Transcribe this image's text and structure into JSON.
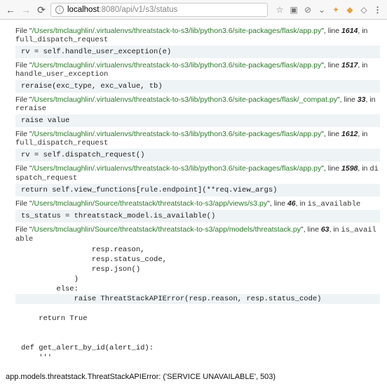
{
  "browser": {
    "url_host": "localhost",
    "url_port": ":8080",
    "url_path": "/api/v1/s3/status"
  },
  "frames": [
    {
      "path": "/Users/tmclaughlin/.virtualenvs/threatstack-to-s3/lib/python3.6/site-packages/flask/app.py",
      "line": "1614",
      "func": "full_dispatch_request",
      "code": "rv = self.handle_user_exception(e)"
    },
    {
      "path": "/Users/tmclaughlin/.virtualenvs/threatstack-to-s3/lib/python3.6/site-packages/flask/app.py",
      "line": "1517",
      "func": "handle_user_exception",
      "code": "reraise(exc_type, exc_value, tb)"
    },
    {
      "path": "/Users/tmclaughlin/.virtualenvs/threatstack-to-s3/lib/python3.6/site-packages/flask/_compat.py",
      "line": "33",
      "func": "reraise",
      "code": "raise value"
    },
    {
      "path": "/Users/tmclaughlin/.virtualenvs/threatstack-to-s3/lib/python3.6/site-packages/flask/app.py",
      "line": "1612",
      "func": "full_dispatch_request",
      "code": "rv = self.dispatch_request()"
    },
    {
      "path": "/Users/tmclaughlin/.virtualenvs/threatstack-to-s3/lib/python3.6/site-packages/flask/app.py",
      "line": "1598",
      "func": "dispatch_request",
      "code": "return self.view_functions[rule.endpoint](**req.view_args)"
    },
    {
      "path": "/Users/tmclaughlin/Source/threatstack/threatstack-to-s3/app/views/s3.py",
      "line": "46",
      "func": "is_available",
      "code": "ts_status = threatstack_model.is_available()"
    }
  ],
  "last_frame": {
    "path": "/Users/tmclaughlin/Source/threatstack/threatstack-to-s3/app/models/threatstack.py",
    "line": "63",
    "func": "is_available",
    "lines": [
      "                resp.reason,",
      "                resp.status_code,",
      "                resp.json()",
      "            )",
      "        else:",
      "            raise ThreatStackAPIError(resp.reason, resp.status_code)",
      "",
      "    return True",
      "",
      "",
      "def get_alert_by_id(alert_id):",
      "    '''"
    ],
    "highlight_index": 5
  },
  "exception": "app.models.threatstack.ThreatStackAPIError: ('SERVICE UNAVAILABLE', 503)"
}
